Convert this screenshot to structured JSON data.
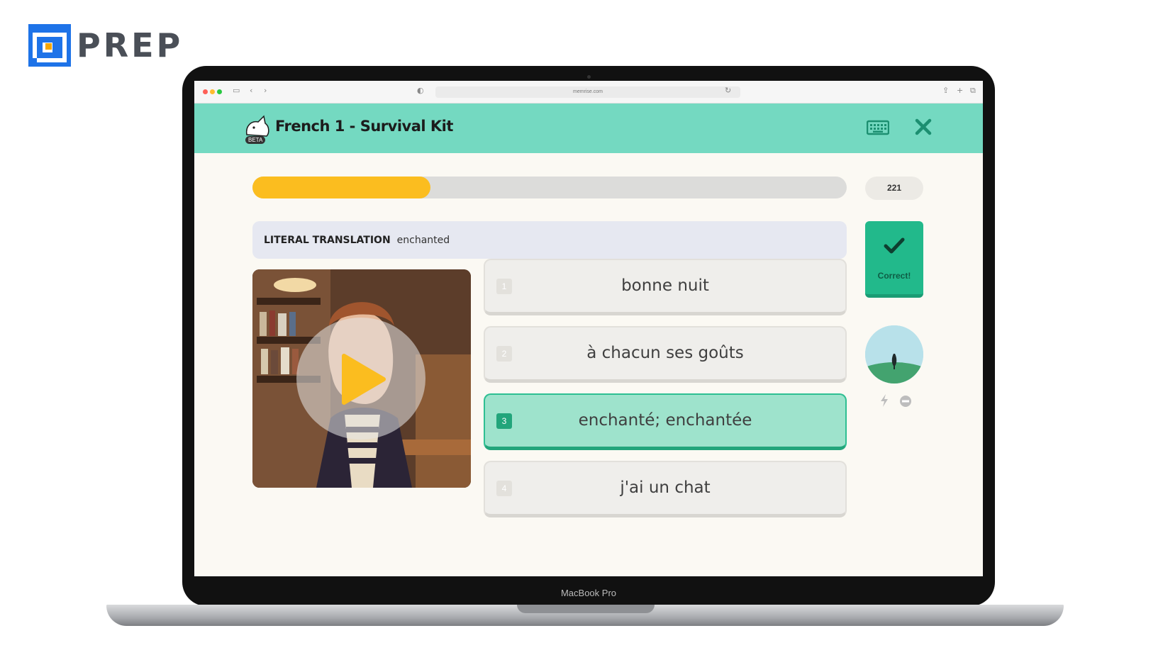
{
  "brand": {
    "name": "PREP",
    "colors": {
      "logo_blue": "#1e73e8",
      "logo_orange": "#f7a600",
      "text": "#4a4f57"
    }
  },
  "device": {
    "label": "MacBook Pro"
  },
  "browser": {
    "url": "memrise.com"
  },
  "header": {
    "title": "French 1 - Survival Kit",
    "badge": "BETA",
    "background": "#74d9c1",
    "icons": [
      "keyboard-icon",
      "close-icon"
    ]
  },
  "progress": {
    "fraction": 0.3,
    "points": "221",
    "fill_color": "#fbbd1f"
  },
  "literal_translation": {
    "label": "LITERAL TRANSLATION",
    "value": "enchanted"
  },
  "correct": {
    "label": "Correct!",
    "color": "#22b98b"
  },
  "options": [
    {
      "number": "1",
      "text": "bonne nuit",
      "selected": false
    },
    {
      "number": "2",
      "text": "à chacun ses goûts",
      "selected": false
    },
    {
      "number": "3",
      "text": "enchanté; enchantée",
      "selected": true
    },
    {
      "number": "4",
      "text": "j'ai un chat",
      "selected": false
    }
  ],
  "video": {
    "icon": "play-icon"
  }
}
